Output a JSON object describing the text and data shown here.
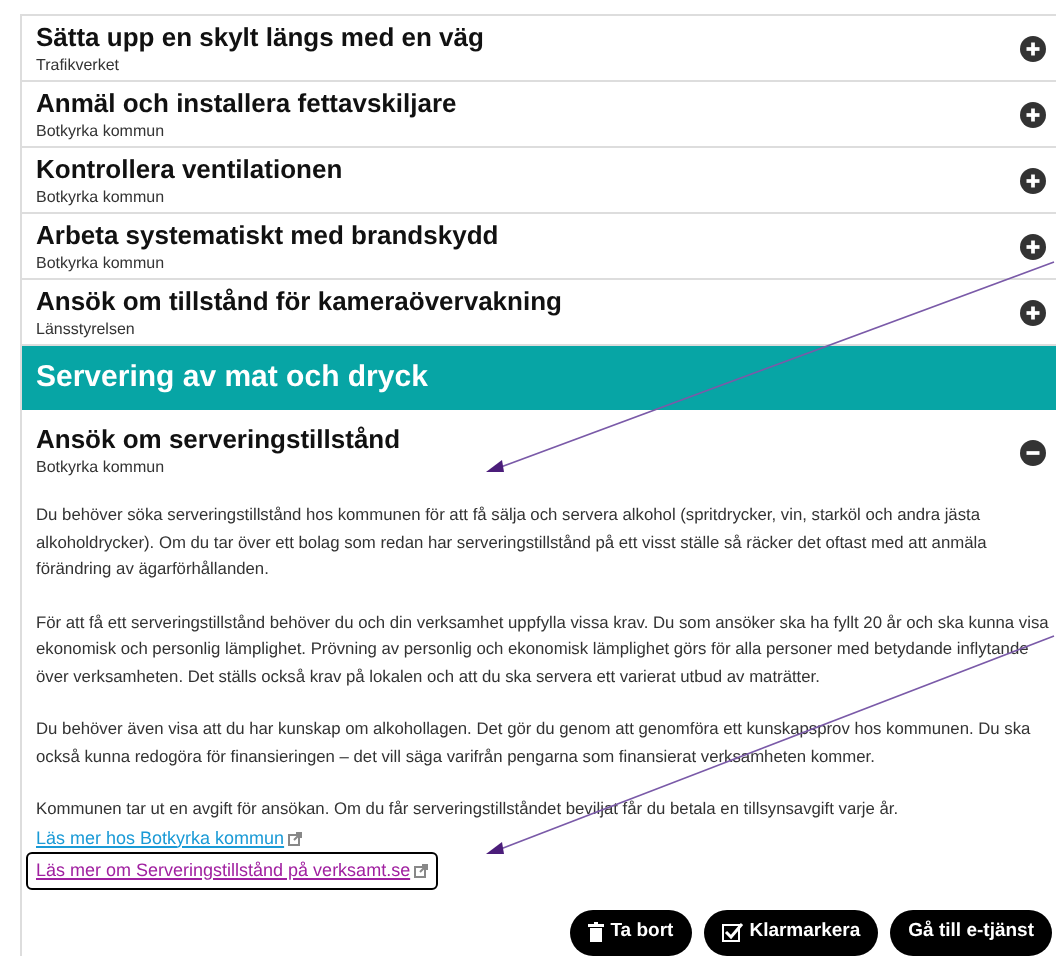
{
  "items": [
    {
      "title": "Sätta upp en skylt längs med en väg",
      "organization": "Trafikverket",
      "expanded": false
    },
    {
      "title": "Anmäl och installera fettavskiljare",
      "organization": "Botkyrka kommun",
      "expanded": false
    },
    {
      "title": "Kontrollera ventilationen",
      "organization": "Botkyrka kommun",
      "expanded": false
    },
    {
      "title": "Arbeta systematiskt med brandskydd",
      "organization": "Botkyrka kommun",
      "expanded": false
    },
    {
      "title": "Ansök om tillstånd för kameraövervakning",
      "organization": "Länsstyrelsen",
      "expanded": false
    }
  ],
  "section": {
    "heading": "Servering av mat och dryck",
    "item": {
      "title": "Ansök om serveringstillstånd",
      "organization": "Botkyrka kommun",
      "expanded": true,
      "paragraphs": [
        "Du behöver söka serveringstillstånd hos kommunen för att få sälja och servera alkohol (spritdrycker, vin, starköl och andra jästa alkoholdrycker). Om du tar över ett bolag som redan har serveringstillstånd på ett visst ställe så räcker det oftast med att anmäla förändring av ägarförhållanden.",
        "För att få ett serveringstillstånd behöver du och din verksamhet uppfylla vissa krav. Du som ansöker ska ha fyllt 20 år och ska kunna visa ekonomisk och personlig lämplighet. Prövning av personlig och ekonomisk lämplighet görs för alla personer med betydande inflytande över verksamheten. Det ställs också krav på lokalen och att du ska servera ett varierat utbud av maträtter.",
        "Du behöver även visa att du har kunskap om alkohollagen. Det gör du genom att genomföra ett kunskapsprov hos kommunen. Du ska också kunna redogöra för finansieringen – det vill säga varifrån pengarna som finansierat verksamheten kommer.",
        "Kommunen tar ut en avgift för ansökan.  Om du får serveringstillståndet beviljat får du betala en tillsynsavgift varje år."
      ],
      "links": [
        {
          "label": "Läs mer hos Botkyrka kommun",
          "visited": false,
          "focused": false
        },
        {
          "label": "Läs mer om Serveringstillstånd på verksamt.se",
          "visited": true,
          "focused": true
        }
      ],
      "buttons": [
        {
          "label": "Ta bort",
          "kind": "trash"
        },
        {
          "label": "Klarmarkera",
          "kind": "check"
        },
        {
          "label": "Gå till e-tjänst",
          "kind": "plain"
        }
      ]
    }
  }
}
